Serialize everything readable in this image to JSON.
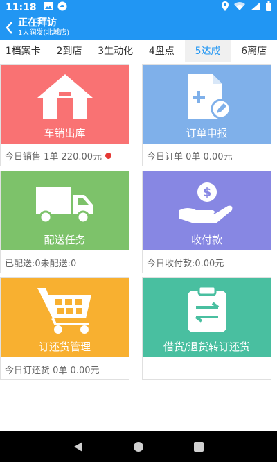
{
  "status": {
    "time": "11:18",
    "icons": [
      "image-icon",
      "android-icon",
      "location-icon",
      "wifi-icon",
      "signal-icon",
      "battery-icon"
    ]
  },
  "appbar": {
    "title": "正在拜访",
    "subtitle": "1大润发(北城店)"
  },
  "tabs": [
    {
      "label": "1档案卡"
    },
    {
      "label": "2到店"
    },
    {
      "label": "3生动化"
    },
    {
      "label": "4盘点"
    },
    {
      "label": "5达成",
      "active": true
    },
    {
      "label": "6离店"
    }
  ],
  "cards": [
    {
      "label": "车销出库",
      "footer": "今日销售 1单 220.00元",
      "color": "#F97273",
      "icon": "warehouse-icon",
      "badge": true
    },
    {
      "label": "订单申报",
      "footer": "今日订单 0单 0.00元",
      "color": "#7FB0EA",
      "icon": "add-document-icon"
    },
    {
      "label": "配送任务",
      "footer": "已配送:0未配送:0",
      "color": "#7DC26A",
      "icon": "delivery-truck-icon"
    },
    {
      "label": "收付款",
      "footer": "今日收付款:0.00元",
      "color": "#8787E3",
      "icon": "hand-coin-icon"
    },
    {
      "label": "订还货管理",
      "footer": "今日订还货 0单 0.00元",
      "color": "#F8B030",
      "icon": "shopping-cart-icon"
    },
    {
      "label": "借货/退货转订还货",
      "footer": "",
      "color": "#49BFA0",
      "icon": "exchange-clipboard-icon"
    }
  ],
  "navbar": {
    "icons": [
      "back-triangle-icon",
      "home-circle-icon",
      "recents-square-icon"
    ]
  }
}
